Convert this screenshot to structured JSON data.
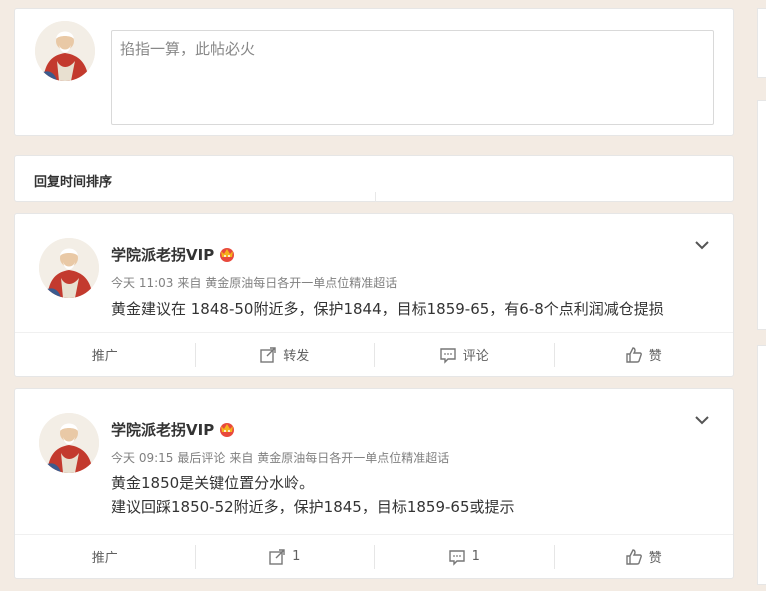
{
  "compose": {
    "placeholder": "掐指一算，此帖必火"
  },
  "sort": {
    "label": "回复时间排序"
  },
  "posts": [
    {
      "author": "学院派老拐VIP",
      "time": "今天 11:03",
      "source": "来自 黄金原油每日各开一单点位精准超话",
      "lines": [
        "黄金建议在 1848-50附近多，保护1844，目标1859-65，有6-8个点利润减仓提损"
      ],
      "actions": {
        "promote": "推广",
        "repost": "转发",
        "comment": "评论",
        "like": "赞"
      }
    },
    {
      "author": "学院派老拐VIP",
      "time": "今天 09:15",
      "last_comment": "最后评论",
      "source": "来自 黄金原油每日各开一单点位精准超话",
      "lines": [
        "黄金1850是关键位置分水岭。",
        "建议回踩1850-52附近多，保护1845，目标1859-65或提示"
      ],
      "actions": {
        "promote": "推广",
        "repost": "1",
        "comment": "1",
        "like": "赞"
      }
    }
  ],
  "icons": {
    "chevron": "chevron-down-icon",
    "repost": "repost-icon",
    "comment": "comment-icon",
    "like": "thumbs-up-icon",
    "vip": "vip-crown-icon"
  },
  "colors": {
    "background": "#f3ebe3",
    "vip_badge": "#e8493d",
    "vip_crown": "#f5b21c"
  }
}
